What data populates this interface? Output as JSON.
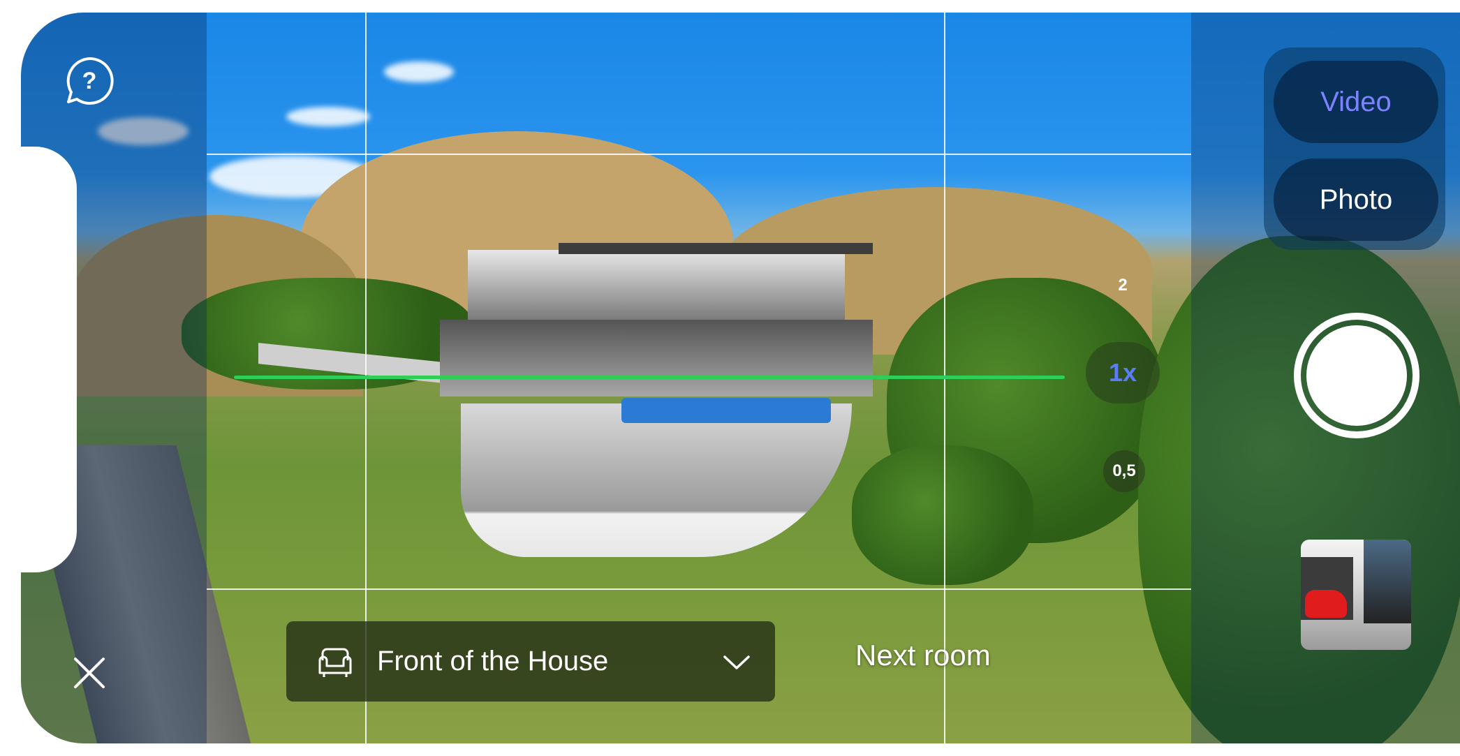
{
  "camera": {
    "help_icon": "help-bubble-icon",
    "close_icon": "close-icon",
    "room_select": {
      "icon": "sofa-icon",
      "value": "Front  of the House",
      "chevron": "chevron-down-icon"
    },
    "next_room_label": "Next room",
    "modes": {
      "video": "Video",
      "photo": "Photo",
      "selected": "Video"
    },
    "zoom": {
      "level_2": "2",
      "level_1": "1x",
      "level_05": "0,5",
      "active": "1x"
    },
    "shutter_icon": "shutter-button",
    "thumbnail": "last-capture-thumbnail",
    "colors": {
      "level_line": "#2ecf58",
      "active_accent": "#7d82ff",
      "zoom_active": "#5b7cf7"
    }
  }
}
